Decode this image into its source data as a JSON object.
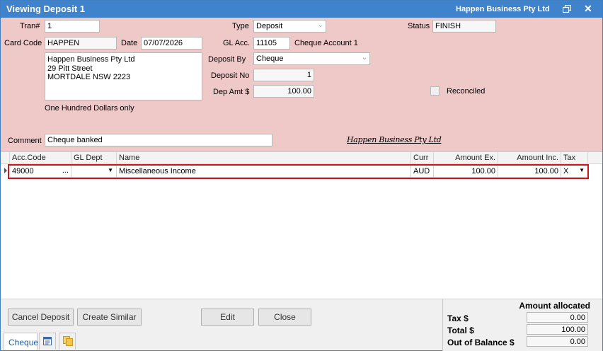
{
  "window": {
    "title": "Viewing Deposit 1",
    "company": "Happen Business Pty Ltd"
  },
  "form": {
    "tran_label": "Tran#",
    "tran_value": "1",
    "type_label": "Type",
    "type_value": "Deposit",
    "status_label": "Status",
    "status_value": "FINISH",
    "card_code_label": "Card Code",
    "card_code_value": "HAPPEN",
    "date_label": "Date",
    "date_value": "07/07/2026",
    "gl_acc_label": "GL Acc.",
    "gl_acc_value": "11105",
    "gl_acc_name": "Cheque Account 1",
    "address_lines": [
      "Happen Business Pty Ltd",
      "29 Pitt Street",
      "MORTDALE NSW 2223"
    ],
    "deposit_by_label": "Deposit By",
    "deposit_by_value": "Cheque",
    "deposit_no_label": "Deposit No",
    "deposit_no_value": "1",
    "dep_amt_label": "Dep Amt $",
    "dep_amt_value": "100.00",
    "reconciled_label": "Reconciled",
    "amount_words": "One Hundred Dollars only",
    "comment_label": "Comment",
    "comment_value": "Cheque banked",
    "signature_text": "Happen Business Pty Ltd"
  },
  "grid": {
    "columns": [
      "Acc.Code",
      "GL Dept",
      "Name",
      "Curr",
      "Amount Ex.",
      "Amount Inc.",
      "Tax"
    ],
    "rows": [
      {
        "acc_code": "49000",
        "acc_ellipsis": "...",
        "gl_dept": "",
        "name": "Miscellaneous Income",
        "curr": "AUD",
        "amount_ex": "100.00",
        "amount_inc": "100.00",
        "tax": "X"
      }
    ]
  },
  "buttons": {
    "cancel_deposit": "Cancel Deposit",
    "create_similar": "Create Similar",
    "edit": "Edit",
    "close": "Close"
  },
  "tabs": {
    "cheque": "Cheque"
  },
  "allocation": {
    "title": "Amount allocated",
    "tax_label": "Tax $",
    "tax_value": "0.00",
    "total_label": "Total $",
    "total_value": "100.00",
    "out_of_balance_label": "Out of Balance $",
    "out_of_balance_value": "0.00"
  },
  "colors": {
    "titlebar": "#3f83cc",
    "form_background": "#efc8c8",
    "highlight_border": "#d0141b"
  }
}
